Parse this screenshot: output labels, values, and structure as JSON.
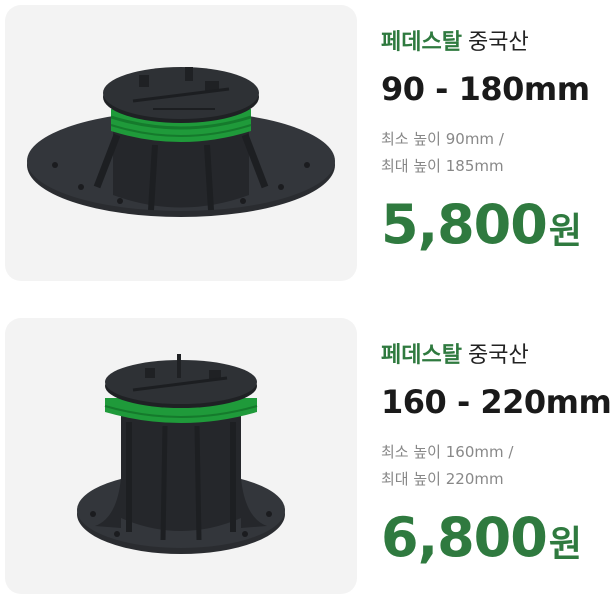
{
  "colors": {
    "brand_green": "#2f7a3f",
    "card_bg": "#f3f3f3",
    "text_dark": "#1a1a1a",
    "text_gray": "#888888",
    "pedestal_black": "#25272b",
    "ring_green": "#1f9a3a"
  },
  "products": [
    {
      "brand": "페데스탈",
      "origin": "중국산",
      "height_range": "90 - 180mm",
      "min_height": "최소 높이 90mm /",
      "max_height": "최대 높이 185mm",
      "price": "5,800",
      "price_unit": "원",
      "image": "short-pedestal-image"
    },
    {
      "brand": "페데스탈",
      "origin": "중국산",
      "height_range": "160 - 220mm",
      "min_height": "최소 높이 160mm /",
      "max_height": "최대 높이 220mm",
      "price": "6,800",
      "price_unit": "원",
      "image": "tall-pedestal-image"
    }
  ]
}
